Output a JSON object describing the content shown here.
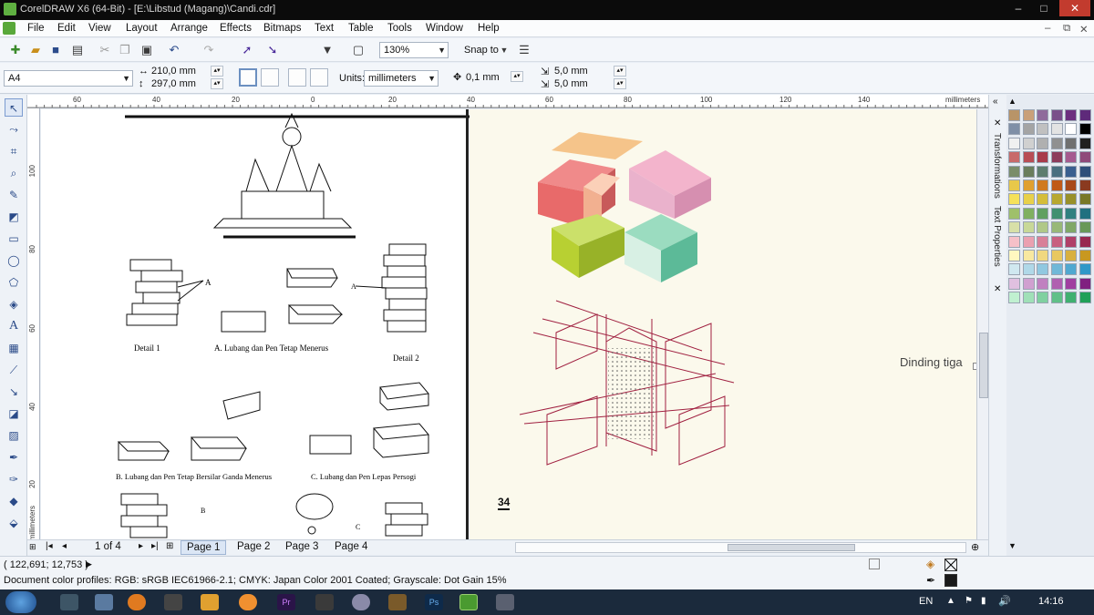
{
  "titlebar": {
    "title": "CorelDRAW X6 (64-Bit) - [E:\\Libstud (Magang)\\Candi.cdr]",
    "min": "‒",
    "max": "□",
    "close": "✕"
  },
  "menu": [
    "File",
    "Edit",
    "View",
    "Layout",
    "Arrange",
    "Effects",
    "Bitmaps",
    "Text",
    "Table",
    "Tools",
    "Window",
    "Help"
  ],
  "toolbar": {
    "zoom": "130%",
    "snap_to": "Snap to"
  },
  "propertybar": {
    "page_size": "A4",
    "width": "210,0 mm",
    "height": "297,0 mm",
    "units_label": "Units:",
    "units": "millimeters",
    "nudge": "0,1 mm",
    "dup_x": "5,0 mm",
    "dup_y": "5,0 mm"
  },
  "ruler": {
    "unit": "millimeters",
    "h_labels": [
      "60",
      "40",
      "20",
      "0",
      "20",
      "40",
      "60",
      "80",
      "100",
      "120",
      "140"
    ],
    "v_labels": [
      "100",
      "80",
      "60",
      "40",
      "20"
    ],
    "v_unit": "millimeters"
  },
  "canvas": {
    "left_captions": [
      "Detail 1",
      "A. Lubang dan Pen Tetap Menerus",
      "Detail 2",
      "B. Lubang dan Pen Tetap Bersilar Ganda Menerus",
      "C. Lubang dan Pen Lepas Persogi"
    ],
    "marker_A": "A",
    "marker_B": "B",
    "marker_C": "C",
    "right_text": "Dinding tiga",
    "page_number": "34"
  },
  "docker_tabs": [
    "Transformations",
    "Text Properties"
  ],
  "pagebar": {
    "counter": "1 of 4",
    "pages": [
      "Page 1",
      "Page 2",
      "Page 3",
      "Page 4"
    ]
  },
  "status": {
    "coords": "( 122,691; 12,753 )",
    "color_profiles": "Document color profiles: RGB: sRGB IEC61966-2.1; CMYK: Japan Color 2001 Coated; Grayscale: Dot Gain 15%"
  },
  "taskbar": {
    "lang": "EN",
    "clock": "14:16"
  },
  "palette_colors": [
    "#b89468",
    "#c9a07a",
    "#8f6b9b",
    "#7a4f8a",
    "#6d2f7f",
    "#5e2a7a",
    "#7f8fa6",
    "#a4a4a4",
    "#c0c0c0",
    "#e3e3e3",
    "#ffffff",
    "#000000",
    "#f0f0f0",
    "#d0d0d0",
    "#b0b0b0",
    "#909090",
    "#707070",
    "#202020",
    "#c86a6a",
    "#b84d55",
    "#a83b4a",
    "#8d3c5c",
    "#a55b8f",
    "#8f4a7a",
    "#7a8d6a",
    "#6a7d5d",
    "#5e7d6e",
    "#4a6f7f",
    "#3a5f8f",
    "#2f4f7a",
    "#e8c84a",
    "#e0a030",
    "#d07a20",
    "#c05a18",
    "#a84a1a",
    "#8a3a20",
    "#f5e15a",
    "#e8d04a",
    "#d4bd3a",
    "#b8a830",
    "#98902a",
    "#787828",
    "#9fc06a",
    "#80b060",
    "#60a060",
    "#409070",
    "#308080",
    "#207080",
    "#d8e0a8",
    "#c8d898",
    "#b0c888",
    "#98b878",
    "#80a868",
    "#689858",
    "#f6c0c8",
    "#eaa0b0",
    "#d88098",
    "#c86080",
    "#b04068",
    "#982850",
    "#fff8c0",
    "#f8e8a0",
    "#f0d880",
    "#e8c860",
    "#d8b040",
    "#c89820",
    "#d0e8f0",
    "#b0d8e8",
    "#90c8e0",
    "#70b8d8",
    "#50a8d0",
    "#3098c8",
    "#e0c0e0",
    "#d0a0d0",
    "#c080c0",
    "#b060b0",
    "#a040a0",
    "#802080",
    "#c0f0d0",
    "#a0e0b8",
    "#80d0a0",
    "#60c088",
    "#40b070",
    "#20a058"
  ],
  "fill_indicator": "#ffffff",
  "outline_indicator": "#000000"
}
